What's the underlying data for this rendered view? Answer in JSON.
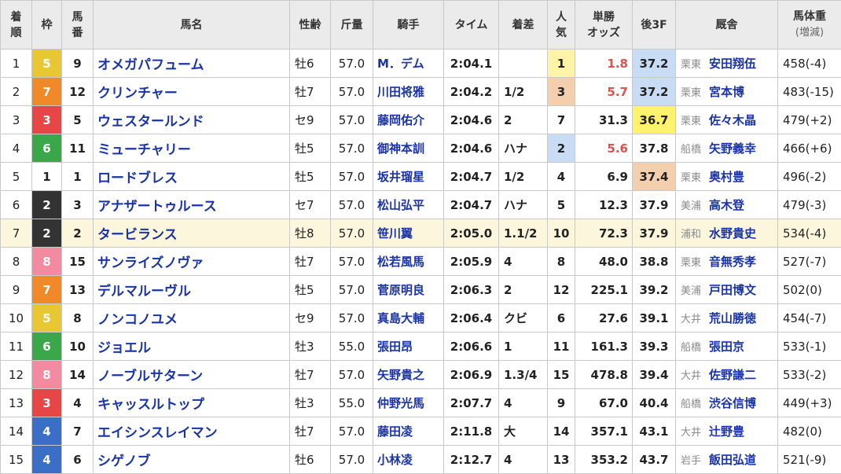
{
  "headers": {
    "rank": [
      "着",
      "順"
    ],
    "waku": "枠",
    "umaban": [
      "馬",
      "番"
    ],
    "horse": "馬名",
    "sexage": "性齢",
    "weight": "斤量",
    "jockey": "騎手",
    "time": "タイム",
    "margin": "着差",
    "pop": [
      "人",
      "気"
    ],
    "odds": [
      "単勝",
      "オッズ"
    ],
    "last3f": "後3F",
    "stable": "厩舎",
    "bodyweight": [
      "馬体重",
      "(増減)"
    ]
  },
  "colors": {
    "waku_1": "#ffffff",
    "waku_2": "#333333",
    "waku_3": "#e64646",
    "waku_4": "#3b6fc7",
    "waku_5": "#e8c832",
    "waku_6": "#3aa84a",
    "waku_7": "#f08a28",
    "waku_8": "#f28aa0",
    "link": "#1a33a6",
    "odds_top": "#d9534f",
    "highlight_row": "#fcf7dc"
  },
  "highlighted_row": 7,
  "rows": [
    {
      "rank": "1",
      "waku": "5",
      "num": "9",
      "horse": "オメガパフューム",
      "sex": "牡6",
      "kin": "57.0",
      "jockey": "M．デム",
      "time": "2:04.1",
      "margin": "",
      "pop": "1",
      "odds": "1.8",
      "f3": "37.2",
      "region": "栗東",
      "trainer": "安田翔伍",
      "bw": "458(-4)"
    },
    {
      "rank": "2",
      "waku": "7",
      "num": "12",
      "horse": "クリンチャー",
      "sex": "牡7",
      "kin": "57.0",
      "jockey": "川田将雅",
      "time": "2:04.2",
      "margin": "1/2",
      "pop": "3",
      "odds": "5.7",
      "f3": "37.2",
      "region": "栗東",
      "trainer": "宮本博",
      "bw": "483(-15)"
    },
    {
      "rank": "3",
      "waku": "3",
      "num": "5",
      "horse": "ウェスタールンド",
      "sex": "セ9",
      "kin": "57.0",
      "jockey": "藤岡佑介",
      "time": "2:04.6",
      "margin": "2",
      "pop": "7",
      "odds": "31.3",
      "f3": "36.7",
      "region": "栗東",
      "trainer": "佐々木晶",
      "bw": "479(+2)"
    },
    {
      "rank": "4",
      "waku": "6",
      "num": "11",
      "horse": "ミューチャリー",
      "sex": "牡5",
      "kin": "57.0",
      "jockey": "御神本訓",
      "time": "2:04.6",
      "margin": "ハナ",
      "pop": "2",
      "odds": "5.6",
      "f3": "37.8",
      "region": "船橋",
      "trainer": "矢野義幸",
      "bw": "466(+6)"
    },
    {
      "rank": "5",
      "waku": "1",
      "num": "1",
      "horse": "ロードブレス",
      "sex": "牡5",
      "kin": "57.0",
      "jockey": "坂井瑠星",
      "time": "2:04.7",
      "margin": "1/2",
      "pop": "4",
      "odds": "6.9",
      "f3": "37.4",
      "region": "栗東",
      "trainer": "奥村豊",
      "bw": "496(-2)"
    },
    {
      "rank": "6",
      "waku": "2",
      "num": "3",
      "horse": "アナザートゥルース",
      "sex": "セ7",
      "kin": "57.0",
      "jockey": "松山弘平",
      "time": "2:04.7",
      "margin": "ハナ",
      "pop": "5",
      "odds": "12.3",
      "f3": "37.9",
      "region": "美浦",
      "trainer": "高木登",
      "bw": "479(-3)"
    },
    {
      "rank": "7",
      "waku": "2",
      "num": "2",
      "horse": "タービランス",
      "sex": "牡8",
      "kin": "57.0",
      "jockey": "笹川翼",
      "time": "2:05.0",
      "margin": "1.1/2",
      "pop": "10",
      "odds": "72.3",
      "f3": "37.9",
      "region": "浦和",
      "trainer": "水野貴史",
      "bw": "534(-4)"
    },
    {
      "rank": "8",
      "waku": "8",
      "num": "15",
      "horse": "サンライズノヴァ",
      "sex": "牡7",
      "kin": "57.0",
      "jockey": "松若風馬",
      "time": "2:05.9",
      "margin": "4",
      "pop": "8",
      "odds": "48.0",
      "f3": "38.8",
      "region": "栗東",
      "trainer": "音無秀孝",
      "bw": "527(-7)"
    },
    {
      "rank": "9",
      "waku": "7",
      "num": "13",
      "horse": "デルマルーヴル",
      "sex": "牡5",
      "kin": "57.0",
      "jockey": "菅原明良",
      "time": "2:06.3",
      "margin": "2",
      "pop": "12",
      "odds": "225.1",
      "f3": "39.2",
      "region": "美浦",
      "trainer": "戸田博文",
      "bw": "502(0)"
    },
    {
      "rank": "10",
      "waku": "5",
      "num": "8",
      "horse": "ノンコノユメ",
      "sex": "セ9",
      "kin": "57.0",
      "jockey": "真島大輔",
      "time": "2:06.4",
      "margin": "クビ",
      "pop": "6",
      "odds": "27.6",
      "f3": "39.1",
      "region": "大井",
      "trainer": "荒山勝徳",
      "bw": "454(-7)"
    },
    {
      "rank": "11",
      "waku": "6",
      "num": "10",
      "horse": "ジョエル",
      "sex": "牡3",
      "kin": "55.0",
      "jockey": "張田昂",
      "time": "2:06.6",
      "margin": "1",
      "pop": "11",
      "odds": "161.3",
      "f3": "39.3",
      "region": "船橋",
      "trainer": "張田京",
      "bw": "533(-1)"
    },
    {
      "rank": "12",
      "waku": "8",
      "num": "14",
      "horse": "ノーブルサターン",
      "sex": "牡7",
      "kin": "57.0",
      "jockey": "矢野貴之",
      "time": "2:06.9",
      "margin": "1.3/4",
      "pop": "15",
      "odds": "478.8",
      "f3": "39.4",
      "region": "大井",
      "trainer": "佐野謙二",
      "bw": "533(-2)"
    },
    {
      "rank": "13",
      "waku": "3",
      "num": "4",
      "horse": "キャッスルトップ",
      "sex": "牡3",
      "kin": "55.0",
      "jockey": "仲野光馬",
      "time": "2:07.7",
      "margin": "4",
      "pop": "9",
      "odds": "67.0",
      "f3": "40.4",
      "region": "船橋",
      "trainer": "渋谷信博",
      "bw": "449(+3)"
    },
    {
      "rank": "14",
      "waku": "4",
      "num": "7",
      "horse": "エイシンスレイマン",
      "sex": "牡7",
      "kin": "57.0",
      "jockey": "藤田凌",
      "time": "2:11.8",
      "margin": "大",
      "pop": "14",
      "odds": "357.1",
      "f3": "43.1",
      "region": "大井",
      "trainer": "辻野豊",
      "bw": "482(0)"
    },
    {
      "rank": "15",
      "waku": "4",
      "num": "6",
      "horse": "シゲノブ",
      "sex": "牡6",
      "kin": "57.0",
      "jockey": "小林凌",
      "time": "2:12.7",
      "margin": "4",
      "pop": "13",
      "odds": "353.2",
      "f3": "43.7",
      "region": "岩手",
      "trainer": "飯田弘道",
      "bw": "521(-9)"
    }
  ]
}
